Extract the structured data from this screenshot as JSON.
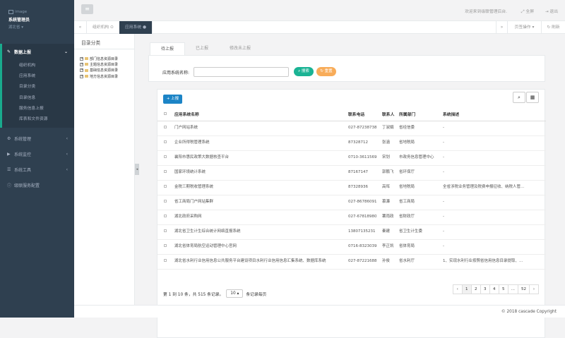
{
  "sidebar": {
    "image_alt": "image",
    "user": "系统管理员",
    "province": "湖北省 ▾",
    "menu": [
      {
        "label": "数据上报",
        "active": true
      },
      {
        "label": "系统管理"
      },
      {
        "label": "系统监控"
      },
      {
        "label": "系统工具"
      },
      {
        "label": "级联服务配置"
      }
    ],
    "submenu": [
      "组织机构",
      "应用系统",
      "目录分类",
      "目录信息",
      "服务信息上报",
      "库表和文件资源"
    ]
  },
  "topbar": {
    "welcome": "欢迎来到级联管理后台.",
    "fullscreen": "全屏",
    "logout": "退出"
  },
  "tabbar": {
    "tabs": [
      "组织机构 ⊙",
      "应用系统 ●"
    ],
    "page_ops": "页签操作 ▾",
    "refresh": "刷新"
  },
  "tree": {
    "title": "目录分类",
    "items": [
      "部门信息资源目录",
      "主题信息资源目录",
      "基础信息资源目录",
      "地方信息资源目录"
    ]
  },
  "main_tabs": [
    "待上报",
    "已上报",
    "修改未上报"
  ],
  "search": {
    "label": "应用系统名称:",
    "search_btn": "搜索",
    "reset_btn": "重置"
  },
  "table": {
    "add_btn": "上报",
    "headers": [
      "应用系统名称",
      "联系电话",
      "联系人",
      "所属部门",
      "系统描述"
    ],
    "rows": [
      [
        "门户网站系统",
        "027-87238738",
        "丁淑娟",
        "省经信委",
        "-"
      ],
      [
        "企业所得税管理系统",
        "87328712",
        "张涵",
        "省地税局",
        "-"
      ],
      [
        "襄阳市惠民政策大数据核查平台",
        "0710-3611569",
        "宋划",
        "市政务信息管理中心",
        "-"
      ],
      [
        "国家环境统计系统",
        "87167147",
        "郭鹏飞",
        "省环保厅",
        "-"
      ],
      [
        "金税三期税收管理系统",
        "87328936",
        "高晖",
        "省地税局",
        "全省涉税业务管理及税费申报征收、纳税人管..."
      ],
      [
        "省工商局门户网站集群",
        "027-86786091",
        "慕濂",
        "省工商局",
        "-"
      ],
      [
        "湖北政府采购网",
        "027-67818980",
        "薯雨政",
        "省财政厅",
        "-"
      ],
      [
        "湖北省卫生计生综合统计网络直报系统",
        "13807135231",
        "秦建",
        "省卫生计生委",
        "-"
      ],
      [
        "湖北省体育局航空运动管理中心官网",
        "0716-8323039",
        "李正凯",
        "省体育局",
        "-"
      ],
      [
        "湖北省水利行业信用信息公共服务平台建设项目水利行业信用信息汇集系统、数据库系统",
        "027-87221688",
        "孙俊",
        "省水利厅",
        "1、实现水利行业按照省信用信息目录提取、..."
      ]
    ]
  },
  "pagination": {
    "info_prefix": "第 1 到 10 条，共 515 条记录。",
    "page_size": "10 ▴",
    "info_suffix": "条记录每页",
    "pages": [
      "‹",
      "1",
      "2",
      "3",
      "4",
      "5",
      "...",
      "52",
      "›"
    ]
  },
  "footer": "© 2018 cascade Copyright"
}
